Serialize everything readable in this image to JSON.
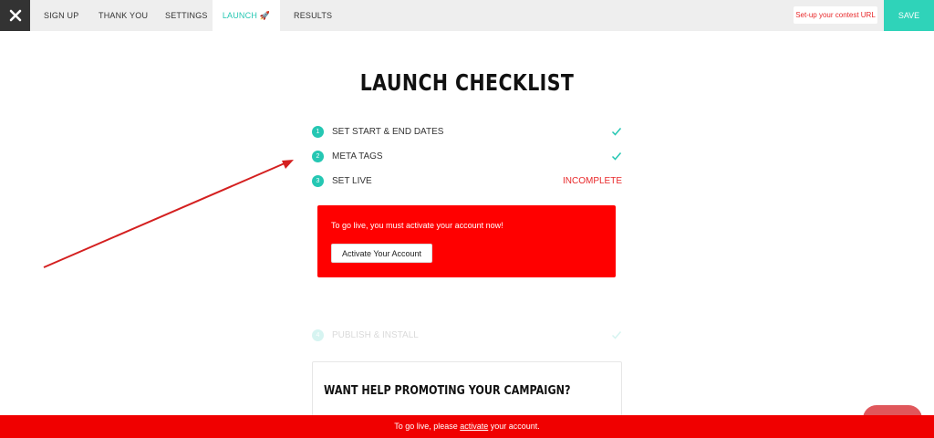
{
  "nav": {
    "close_icon": "close-icon",
    "tabs": [
      {
        "label": "SIGN UP"
      },
      {
        "label": "THANK YOU"
      },
      {
        "label": "SETTINGS"
      },
      {
        "label": "LAUNCH 🚀"
      },
      {
        "label": "RESULTS"
      }
    ],
    "active_tab": "LAUNCH",
    "contest_url_label": "Set-up your contest URL",
    "save_label": "SAVE"
  },
  "page": {
    "title": "LAUNCH CHECKLIST"
  },
  "checklist": [
    {
      "number": "1",
      "label": "SET START & END DATES",
      "status_icon": "check-icon"
    },
    {
      "number": "2",
      "label": "META TAGS",
      "status_icon": "check-icon"
    },
    {
      "number": "3",
      "label": "SET LIVE",
      "status": "INCOMPLETE"
    },
    {
      "number": "4",
      "label": "PUBLISH & INSTALL",
      "status_icon": "check-icon"
    }
  ],
  "alert": {
    "message": "To go live, you must activate your account now!",
    "button_label": "Activate Your Account"
  },
  "promo": {
    "title": "WANT HELP PROMOTING YOUR CAMPAIGN?"
  },
  "bottom_banner": {
    "prefix": "To go live, please ",
    "link": "activate",
    "suffix": " your account."
  },
  "colors": {
    "accent": "#25c7b3",
    "save": "#2fd3b9",
    "alert": "#ff0000",
    "incomplete": "#e8282a",
    "arrow": "#d42020"
  }
}
